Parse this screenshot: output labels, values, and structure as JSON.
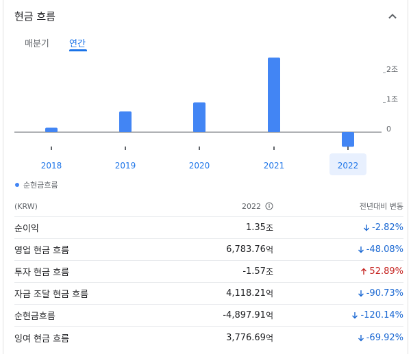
{
  "header": {
    "title": "현금 흐름",
    "collapse_icon": "chevron-up-icon"
  },
  "tabs": [
    {
      "label": "매분기",
      "selected": false
    },
    {
      "label": "연간",
      "selected": true
    }
  ],
  "colors": {
    "accent": "#1a73e8",
    "bar": "#4285f4",
    "negative": "#1967d2",
    "positive": "#c5221f",
    "selected_year_bg": "#e8f0fe"
  },
  "chart_data": {
    "type": "bar",
    "categories": [
      "2018",
      "2019",
      "2020",
      "2021",
      "2022"
    ],
    "series": [
      {
        "name": "순현금흐름",
        "values": [
          0.15,
          0.7,
          1.0,
          2.5,
          -0.49
        ]
      }
    ],
    "y_tick_labels": [
      "2조",
      "1조",
      "0"
    ],
    "y_ticks": [
      2,
      1,
      0
    ],
    "ylim": [
      -0.55,
      2.55
    ],
    "selected_category": "2022",
    "legend_position": "bottom-left"
  },
  "legend": {
    "label": "순현금흐름"
  },
  "table": {
    "header": {
      "unit_label": "(KRW)",
      "year_label": "2022",
      "change_label": "전년대비 변동"
    },
    "rows": [
      {
        "label": "순이익",
        "value": "1.35",
        "unit": "조",
        "change": "-2.82%",
        "direction": "down"
      },
      {
        "label": "영업 현금 흐름",
        "value": "6,783.76",
        "unit": "억",
        "change": "-48.08%",
        "direction": "down"
      },
      {
        "label": "투자 현금 흐름",
        "value": "-1.57",
        "unit": "조",
        "change": "52.89%",
        "direction": "up"
      },
      {
        "label": "자금 조달 현금 흐름",
        "value": "4,118.21",
        "unit": "억",
        "change": "-90.73%",
        "direction": "down"
      },
      {
        "label": "순현금흐름",
        "value": "-4,897.91",
        "unit": "억",
        "change": "-120.14%",
        "direction": "down"
      },
      {
        "label": "잉여 현금 흐름",
        "value": "3,776.69",
        "unit": "억",
        "change": "-69.92%",
        "direction": "down"
      }
    ]
  }
}
